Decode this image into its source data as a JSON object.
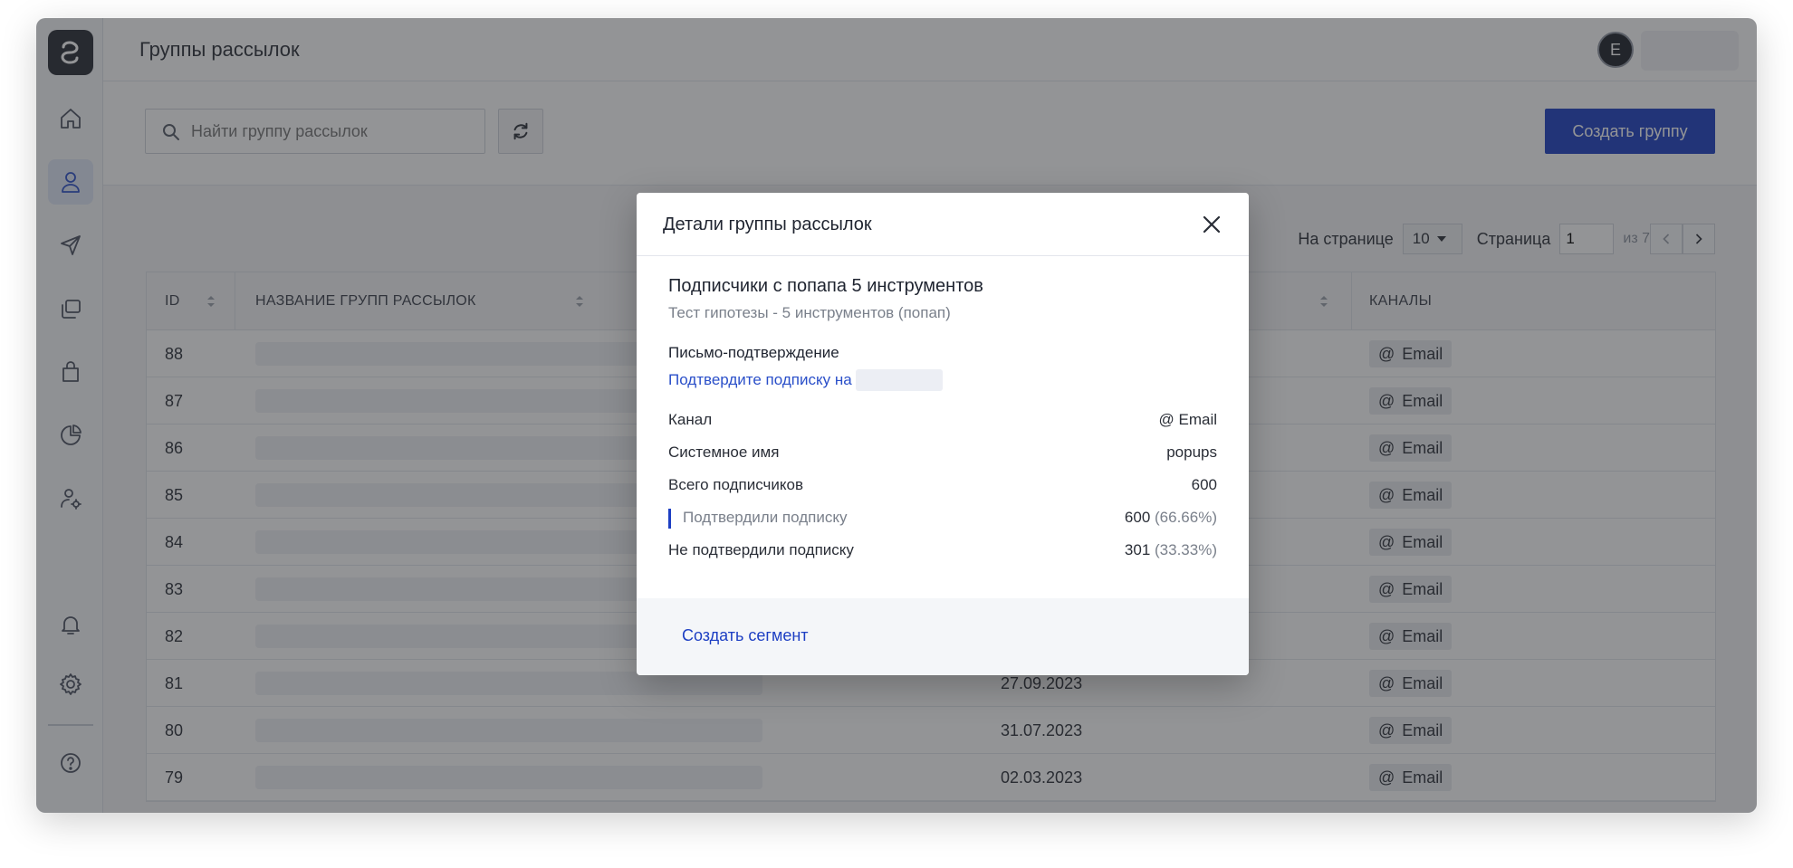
{
  "header": {
    "title": "Группы рассылок",
    "avatar_letter": "E"
  },
  "toolbar": {
    "search_placeholder": "Найти группу рассылок",
    "create_label": "Создать группу"
  },
  "pagination": {
    "per_page_label": "На странице",
    "per_page_value": "10",
    "page_label": "Страница",
    "page_value": "1",
    "of_label": "из 7"
  },
  "table": {
    "columns": {
      "id": "ID",
      "name": "НАЗВАНИЕ ГРУПП РАССЫЛОК",
      "channels": "КАНАЛЫ"
    },
    "channel_label": "Email",
    "rows": [
      {
        "id": "88",
        "date": ""
      },
      {
        "id": "87",
        "date": ""
      },
      {
        "id": "86",
        "date": ""
      },
      {
        "id": "85",
        "date": ""
      },
      {
        "id": "84",
        "date": ""
      },
      {
        "id": "83",
        "date": ""
      },
      {
        "id": "82",
        "date": ""
      },
      {
        "id": "81",
        "date": "27.09.2023"
      },
      {
        "id": "80",
        "date": "31.07.2023"
      },
      {
        "id": "79",
        "date": "02.03.2023"
      }
    ]
  },
  "modal": {
    "title": "Детали группы рассылок",
    "group_name": "Подписчики с попапа 5 инструментов",
    "group_description": "Тест гипотезы - 5 инструментов (попап)",
    "confirm_section_label": "Письмо-подтверждение",
    "confirm_link_text": "Подтвердите подписку на",
    "details": {
      "channel_key": "Канал",
      "channel_value": "Email",
      "system_name_key": "Системное имя",
      "system_name_value": "popups",
      "total_key": "Всего подписчиков",
      "total_value": "600",
      "confirmed_key": "Подтвердили подписку",
      "confirmed_value": "600",
      "confirmed_pct": "(66.66%)",
      "unconfirmed_key": "Не подтвердили подписку",
      "unconfirmed_value": "301",
      "unconfirmed_pct": "(33.33%)"
    },
    "create_segment_label": "Создать сегмент"
  }
}
